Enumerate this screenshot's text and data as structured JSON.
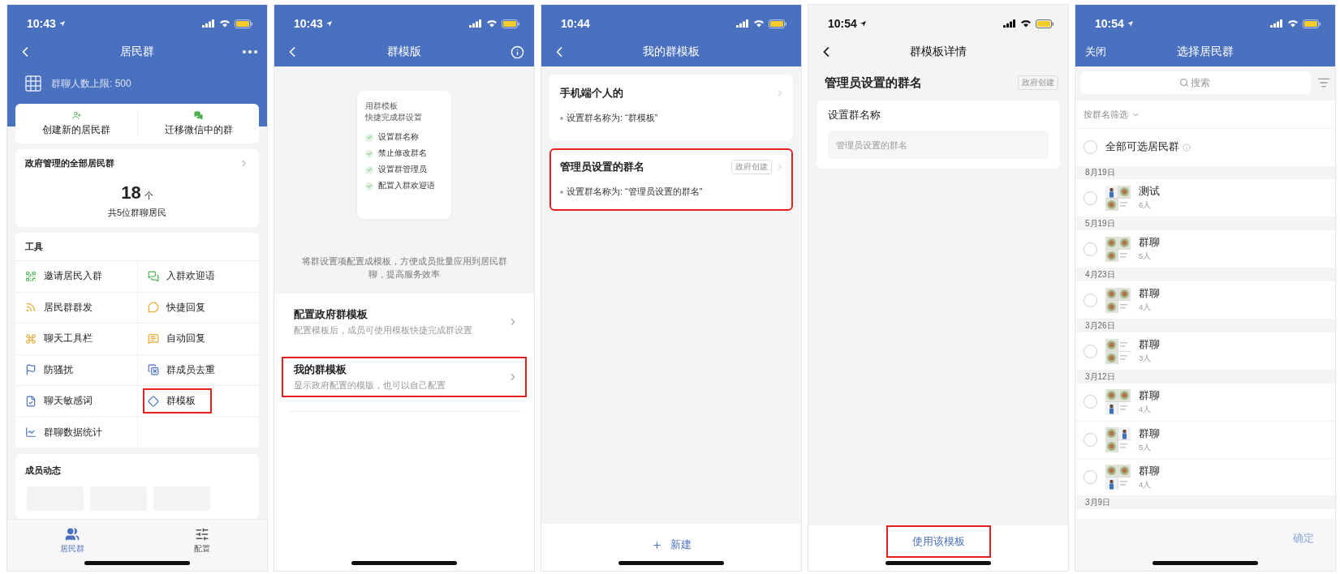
{
  "screens": [
    {
      "kind": "residents",
      "status": {
        "time": "10:43",
        "location": true
      },
      "nav": {
        "title": "居民群"
      },
      "limit": "群聊人数上限: 500",
      "actions": [
        {
          "label": "创建新的居民群"
        },
        {
          "label": "迁移微信中的群"
        }
      ],
      "summary": {
        "title": "政府管理的全部居民群",
        "count": "18",
        "unit": "个",
        "caption": "共5位群聊居民"
      },
      "tools": {
        "title": "工具",
        "items": [
          {
            "label": "邀请居民入群",
            "highlighted": false
          },
          {
            "label": "入群欢迎语",
            "highlighted": false
          },
          {
            "label": "居民群群发",
            "highlighted": false
          },
          {
            "label": "快捷回复",
            "highlighted": false
          },
          {
            "label": "聊天工具栏",
            "highlighted": false
          },
          {
            "label": "自动回复",
            "highlighted": false
          },
          {
            "label": "防骚扰",
            "highlighted": false
          },
          {
            "label": "群成员去重",
            "highlighted": false
          },
          {
            "label": "聊天敏感词",
            "highlighted": false
          },
          {
            "label": "群模板",
            "highlighted": true
          },
          {
            "label": "群聊数据统计",
            "highlighted": false
          }
        ]
      },
      "activity": {
        "title": "成员动态"
      },
      "tabs": [
        {
          "label": "居民群",
          "selected": true
        },
        {
          "label": "配置",
          "selected": false
        }
      ]
    },
    {
      "kind": "intro",
      "status": {
        "time": "10:43",
        "location": true
      },
      "nav": {
        "title": "群模版"
      },
      "card": {
        "lines": [
          "用群模板",
          "快捷完成群设置"
        ],
        "checks": [
          "设置群名称",
          "禁止修改群名",
          "设置群管理员",
          "配置入群欢迎语"
        ]
      },
      "description": "将群设置项配置成模板，方便成员批量应用到居民群聊，提高服务效率",
      "items": [
        {
          "title": "配置政府群模板",
          "subtitle": "配置模板后，成员可使用模板快捷完成群设置",
          "highlighted": false
        },
        {
          "title": "我的群模板",
          "subtitle": "显示政府配置的模版，也可以自己配置",
          "highlighted": true
        }
      ]
    },
    {
      "kind": "templates",
      "status": {
        "time": "10:44",
        "location": false
      },
      "nav": {
        "title": "我的群模板"
      },
      "cards": [
        {
          "title": "手机端个人的",
          "detail": "设置群名称为: “群模板”",
          "highlighted": false
        },
        {
          "title": "管理员设置的群名",
          "badge": "政府创建",
          "detail": "设置群名称为: “管理员设置的群名”",
          "highlighted": true
        }
      ],
      "footer": {
        "label": "新建"
      }
    },
    {
      "kind": "detail",
      "status": {
        "time": "10:54",
        "location": true
      },
      "nav": {
        "title": "群模板详情"
      },
      "title": "管理员设置的群名",
      "badge": "政府创建",
      "field": {
        "label": "设置群名称",
        "placeholder": "管理员设置的群名"
      },
      "action": {
        "label": "使用该模板",
        "highlighted": true
      }
    },
    {
      "kind": "select",
      "status": {
        "time": "10:54",
        "location": true
      },
      "nav": {
        "left": "关闭",
        "title": "选择居民群"
      },
      "search": {
        "placeholder": "搜索"
      },
      "filter": "按群名筛选",
      "all": {
        "label": "全部可选居民群",
        "selected": false
      },
      "sections": [
        {
          "date": "8月19日",
          "groups": [
            {
              "name": "测试",
              "members": "6人",
              "selected": false
            }
          ]
        },
        {
          "date": "5月19日",
          "groups": [
            {
              "name": "群聊",
              "members": "5人",
              "selected": false
            }
          ]
        },
        {
          "date": "4月23日",
          "groups": [
            {
              "name": "群聊",
              "members": "4人",
              "selected": false
            }
          ]
        },
        {
          "date": "3月26日",
          "groups": [
            {
              "name": "群聊",
              "members": "3人",
              "selected": false
            }
          ]
        },
        {
          "date": "3月12日",
          "groups": [
            {
              "name": "群聊",
              "members": "4人",
              "selected": false
            },
            {
              "name": "群聊",
              "members": "5人",
              "selected": false
            },
            {
              "name": "群聊",
              "members": "4人",
              "selected": false
            }
          ]
        },
        {
          "date": "3月9日"
        }
      ],
      "confirm": {
        "label": "确定",
        "disabled": true
      }
    }
  ]
}
